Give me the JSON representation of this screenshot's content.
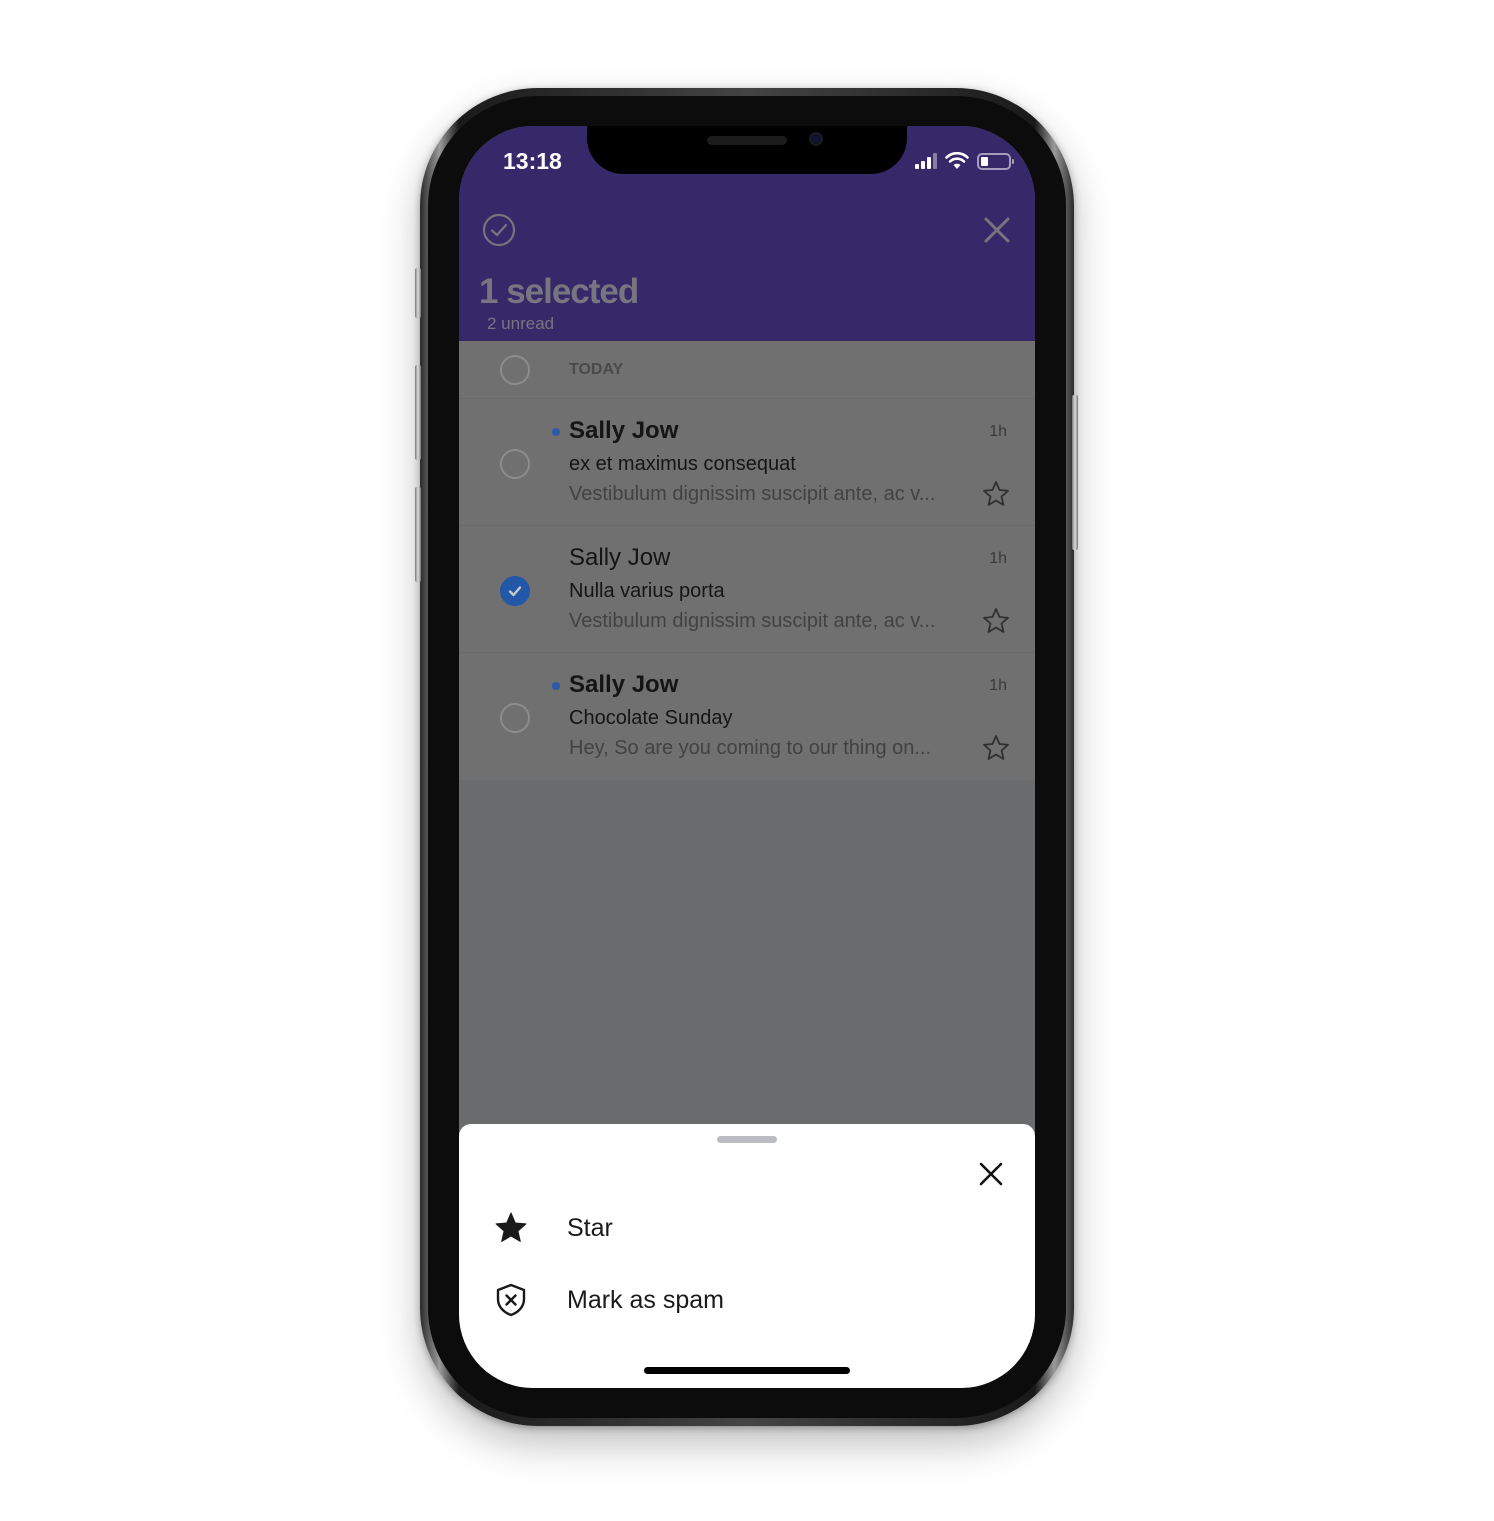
{
  "status_bar": {
    "time": "13:18",
    "icons": [
      "cellular-signal-icon",
      "wifi-icon",
      "battery-icon"
    ]
  },
  "header": {
    "title": "1 selected",
    "subtitle": "2 unread",
    "left_icon": "select-all-check-circle-icon",
    "right_icon": "close-icon",
    "background_color": "#35296a"
  },
  "list": {
    "section_label": "TODAY",
    "messages": [
      {
        "sender": "Sally Jow",
        "subject": "ex et maximus consequat",
        "preview": "Vestibulum dignissim suscipit ante, ac v...",
        "time": "1h",
        "unread": true,
        "selected": false,
        "starred": false
      },
      {
        "sender": "Sally Jow",
        "subject": "Nulla varius porta",
        "preview": "Vestibulum dignissim suscipit ante, ac v...",
        "time": "1h",
        "unread": false,
        "selected": true,
        "starred": false
      },
      {
        "sender": "Sally Jow",
        "subject": "Chocolate Sunday",
        "preview": "Hey, So are you coming to our thing on...",
        "time": "1h",
        "unread": true,
        "selected": false,
        "starred": false
      }
    ]
  },
  "action_sheet": {
    "close_icon": "close-icon",
    "actions": [
      {
        "label": "Star",
        "icon": "star-filled-icon"
      },
      {
        "label": "Mark as spam",
        "icon": "shield-x-icon"
      }
    ]
  },
  "colors": {
    "accent": "#2357a8",
    "unread_dot": "#2c5aa8",
    "overlay": "#6b6c6e"
  }
}
